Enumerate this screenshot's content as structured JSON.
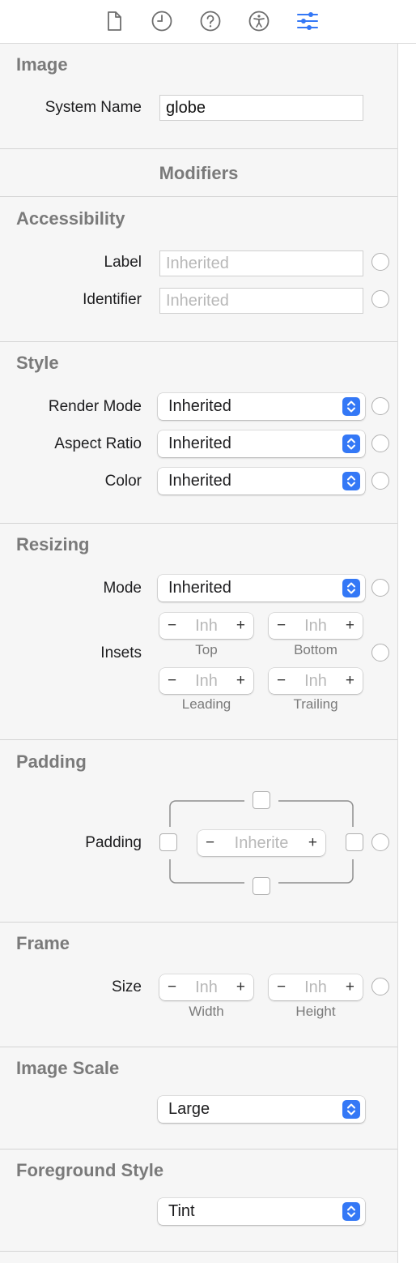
{
  "tabs": [
    {
      "id": "file",
      "icon": "file-icon"
    },
    {
      "id": "history",
      "icon": "clock-icon"
    },
    {
      "id": "help",
      "icon": "help-icon"
    },
    {
      "id": "accessibility",
      "icon": "accessibility-icon"
    },
    {
      "id": "attributes",
      "icon": "sliders-icon",
      "active": true
    }
  ],
  "colors": {
    "accent": "#3478f6",
    "section_title": "#7a7a7a"
  },
  "image": {
    "title": "Image",
    "system_name_label": "System Name",
    "system_name_value": "globe"
  },
  "modifiers_title": "Modifiers",
  "accessibility": {
    "title": "Accessibility",
    "label_label": "Label",
    "label_placeholder": "Inherited",
    "identifier_label": "Identifier",
    "identifier_placeholder": "Inherited"
  },
  "style": {
    "title": "Style",
    "render_mode_label": "Render Mode",
    "render_mode_value": "Inherited",
    "aspect_ratio_label": "Aspect Ratio",
    "aspect_ratio_value": "Inherited",
    "color_label": "Color",
    "color_value": "Inherited"
  },
  "resizing": {
    "title": "Resizing",
    "mode_label": "Mode",
    "mode_value": "Inherited",
    "insets_label": "Insets",
    "top_value": "Inh",
    "top_label": "Top",
    "bottom_value": "Inh",
    "bottom_label": "Bottom",
    "leading_value": "Inh",
    "leading_label": "Leading",
    "trailing_value": "Inh",
    "trailing_label": "Trailing"
  },
  "padding": {
    "title": "Padding",
    "label": "Padding",
    "value": "Inherite"
  },
  "frame": {
    "title": "Frame",
    "size_label": "Size",
    "width_value": "Inh",
    "width_label": "Width",
    "height_value": "Inh",
    "height_label": "Height"
  },
  "image_scale": {
    "title": "Image Scale",
    "value": "Large"
  },
  "foreground_style": {
    "title": "Foreground Style",
    "value": "Tint"
  },
  "stepper": {
    "minus": "−",
    "plus": "+"
  }
}
